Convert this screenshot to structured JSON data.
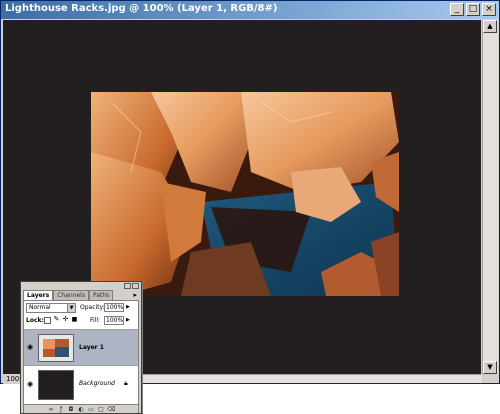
{
  "window": {
    "title": "Lighthouse Racks.jpg @ 100% (Layer 1, RGB/8#)",
    "minimize": "_",
    "maximize": "□",
    "close": "×"
  },
  "status": {
    "zoom": "100%"
  },
  "scroll": {
    "up": "▲",
    "down": "▼",
    "left": "◀",
    "right": "▶"
  },
  "layers_palette": {
    "tabs": [
      "Layers",
      "Channels",
      "Paths"
    ],
    "menu_icon": "▸",
    "blend_mode": "Normal",
    "opacity_label": "Opacity:",
    "opacity_value": "100%",
    "lock_label": "Lock:",
    "fill_label": "Fill:",
    "fill_value": "100%",
    "layers": [
      {
        "name": "Layer 1",
        "visible": true,
        "selected": true
      },
      {
        "name": "Background",
        "visible": true,
        "selected": false,
        "locked": true
      }
    ],
    "footer_icons": [
      "link-icon",
      "layer-style-icon",
      "mask-icon",
      "adjustment-icon",
      "folder-icon",
      "new-layer-icon",
      "trash-icon"
    ]
  },
  "colors": {
    "canvas": "#231f20",
    "title_start": "#3a6ea5",
    "title_end": "#a6caf0",
    "selected_layer": "#aeb4c4"
  }
}
